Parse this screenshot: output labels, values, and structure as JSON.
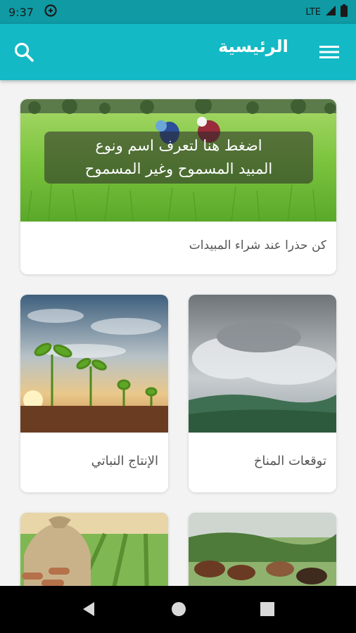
{
  "status_bar": {
    "time": "9:37",
    "network": "LTE",
    "icons": [
      "data-saver-icon",
      "signal-icon",
      "battery-icon"
    ]
  },
  "app_bar": {
    "title": "الرئيسية",
    "icons": [
      "search-icon",
      "menu-icon"
    ],
    "color": "#13b9c5"
  },
  "banner": {
    "overlay_line1": "اضغط هنا لتعرف اسم ونوع",
    "overlay_line2": "المبيد المسموح وغير المسموح",
    "caption": "كن حذرا عند شراء المبيدات"
  },
  "grid": [
    {
      "caption": "الإنتاج النباتي"
    },
    {
      "caption": "توقعات المناخ"
    }
  ],
  "nav_bar": {
    "icons": [
      "back-icon",
      "home-icon",
      "recents-icon"
    ]
  }
}
